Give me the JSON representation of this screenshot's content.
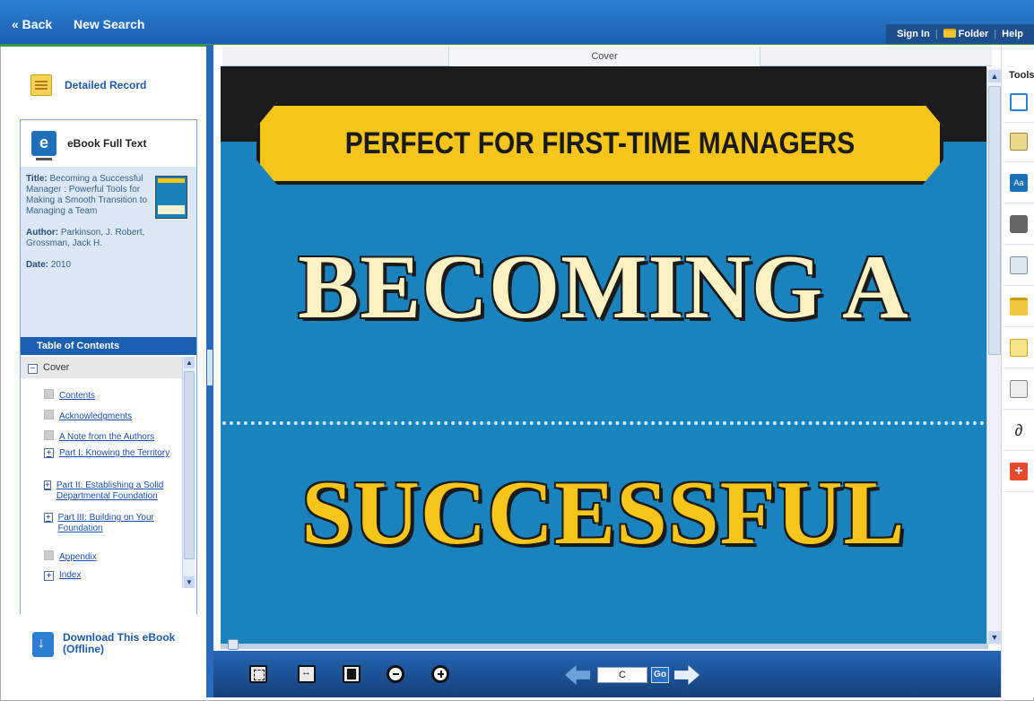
{
  "topbar": {
    "back_label": "« Back",
    "new_search_label": "New Search",
    "sign_in_label": "Sign In",
    "folder_label": "Folder",
    "help_label": "Help"
  },
  "left": {
    "detailed_record_label": "Detailed Record",
    "ebook_full_text_label": "eBook Full Text",
    "title_label": "Title:",
    "title_value": "Becoming a Successful Manager : Powerful Tools for Making a Smooth Transition to Managing a Team",
    "author_label": "Author:",
    "author_value": "Parkinson, J. Robert, Grossman, Jack H.",
    "date_label": "Date:",
    "date_value": "2010",
    "toc_header": "Table of Contents",
    "toc_cover": "Cover",
    "toc_items": [
      "Contents",
      "Acknowledgments",
      "A Note from the Authors",
      "Part I: Knowing the Territory",
      "Part II: Establishing a Solid Departmental Foundation",
      "Part III: Building on Your Foundation",
      "Appendix",
      "Index"
    ],
    "download_label": "Download This eBook (Offline)"
  },
  "reader": {
    "page_tab_label": "Cover",
    "banner_text": "PERFECT FOR FIRST-TIME MANAGERS",
    "big_word_1": "BECOMING A",
    "big_word_2": "SUCCESSFUL",
    "page_input_value": "C",
    "go_label": "Go"
  },
  "tools": {
    "title": "Tools",
    "icons": [
      "search-inside-icon",
      "add-to-folder-icon",
      "dictionary-icon",
      "print-icon",
      "email-icon",
      "save-icon",
      "cite-icon",
      "export-icon",
      "permalink-icon",
      "share-plus-icon"
    ]
  }
}
